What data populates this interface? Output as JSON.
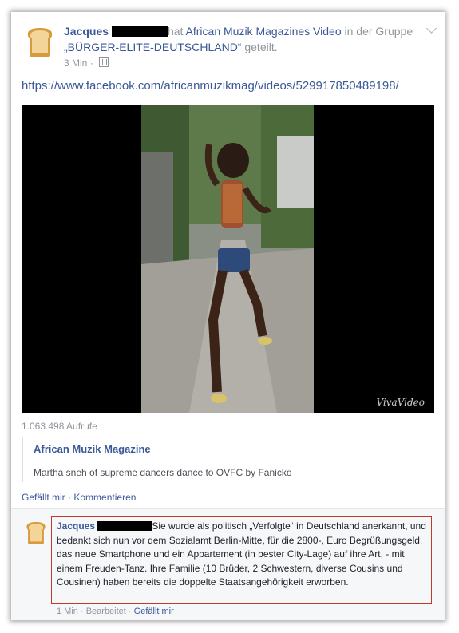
{
  "post": {
    "author": "Jacques",
    "action_text": "hat",
    "shared_link": "African Muzik Magazine",
    "shared_link_suffix": "s Video",
    "group_prefix": "in der Gruppe",
    "group_name": "„BÜRGER-ELITE-DEUTSCHLAND“",
    "group_suffix": "geteilt.",
    "time": "3 Min",
    "privacy_icon": "group-icon",
    "url": "https://www.facebook.com/africanmuzikmag/videos/529917850489198/",
    "video_watermark": "VivaVideo",
    "views": "1.063.498 Aufrufe",
    "attachment_title": "African Muzik Magazine",
    "attachment_description": "Martha sneh of supreme dancers dance to OVFC by Fanicko",
    "like_label": "Gefällt mir",
    "separator": "·",
    "comment_label": "Kommentieren"
  },
  "comment": {
    "author": "Jacques",
    "text": "Sie wurde als politisch „Verfolgte“ in Deutschland anerkannt, und bedankt sich nun vor dem Sozialamt Berlin-Mitte, für die 2800-, Euro Begrüßungsgeld, das neue Smartphone und ein Appartement (in bester City-Lage) auf ihre Art, - mit einem Freuden-Tanz. Ihre Familie (10 Brüder, 2 Schwestern, diverse Cousins und Cousinen) haben bereits die doppelte Staatsangehörigkeit erworben.",
    "time": "1 Min",
    "separator": "·",
    "edited": "Bearbeitet",
    "like_label": "Gefällt mir"
  },
  "colors": {
    "link": "#3b5998",
    "meta": "#90949c",
    "highlight_border": "#c0392b"
  }
}
